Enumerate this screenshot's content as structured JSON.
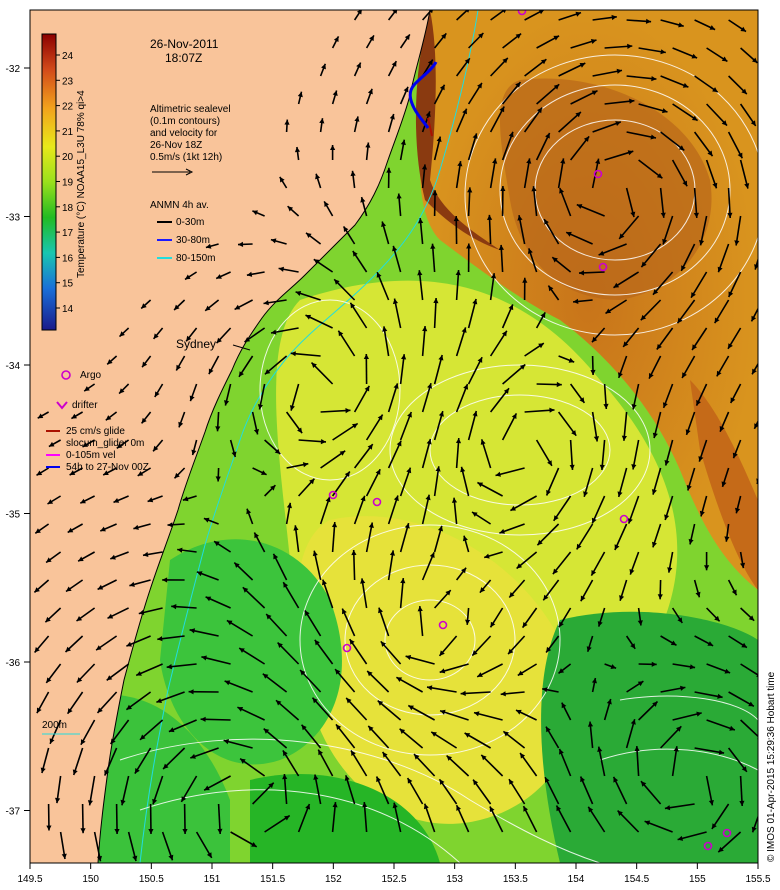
{
  "map": {
    "date": "26-Nov-2011",
    "time": "18:07Z",
    "altimetry_lines": [
      "Altimetric sealevel",
      "(0.1m contours)",
      "and velocity for",
      "26-Nov 18Z",
      "0.5m/s (1kt 12h)"
    ],
    "anmn_title": "ANMN 4h av.",
    "anmn_items": [
      {
        "label": "0-30m",
        "color": "#000000"
      },
      {
        "label": "30-80m",
        "color": "#1a1aff"
      },
      {
        "label": "80-150m",
        "color": "#22dddd"
      }
    ],
    "city": "Sydney",
    "argo_label": "Argo",
    "drifter_label": "drifter",
    "glider_lines": [
      {
        "label": "25 cm/s glide",
        "color": "#aa1100"
      },
      {
        "label": "slocum_glider 0m",
        "color": ""
      },
      {
        "label": "0-105m vel",
        "color": "#ff00ff"
      },
      {
        "label": "54h to 27-Nov 00Z",
        "color": "#0000ee"
      }
    ],
    "depth_label": "200m",
    "credit": "© IMOS 01-Apr-2015 15:29:36 Hobart time",
    "colorbar": {
      "title": "Temperature (°C) NOAA15_L3U 78% qi>4",
      "ticks": [
        "24",
        "23",
        "22",
        "21",
        "20",
        "19",
        "18",
        "17",
        "16",
        "15",
        "14"
      ]
    },
    "x_ticks": [
      "149.5",
      "150",
      "150.5",
      "151",
      "151.5",
      "152",
      "152.5",
      "153",
      "153.5",
      "154",
      "154.5",
      "155",
      "155.5"
    ],
    "y_ticks": [
      "-32",
      "-33",
      "-34",
      "-35",
      "-36",
      "-37"
    ],
    "colors": {
      "land": "#f9c49a",
      "warm": "#d98a18",
      "cool": "#2fc12f",
      "mid": "#c8e81e",
      "contour": "#ffffff",
      "argo": "#cc00cc"
    }
  }
}
